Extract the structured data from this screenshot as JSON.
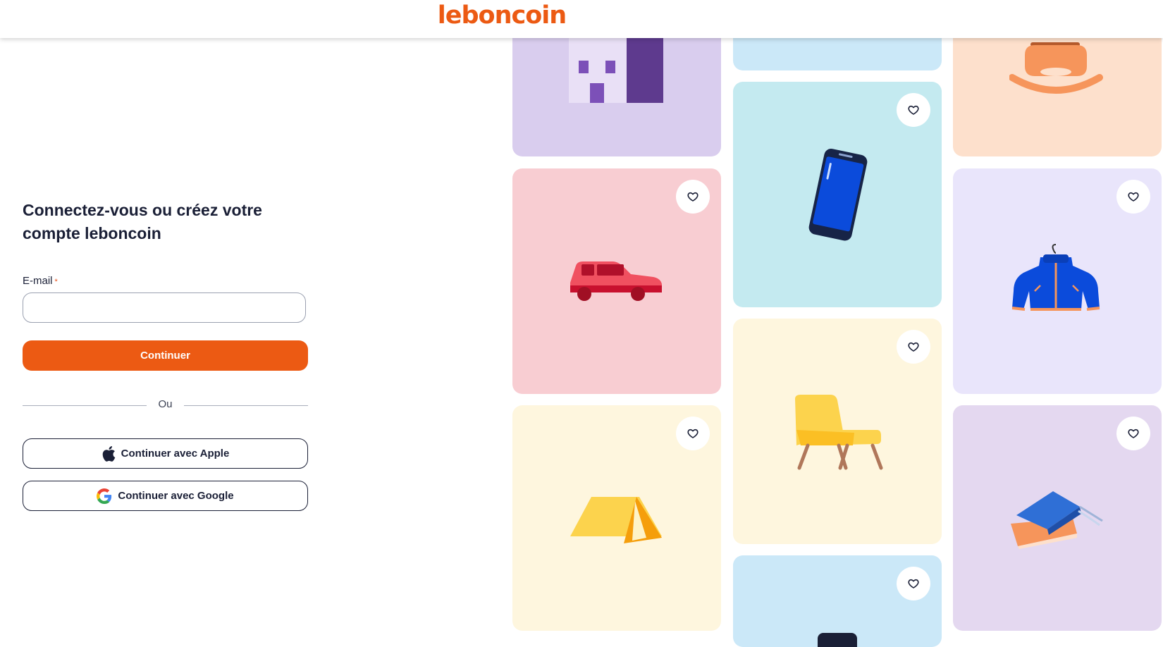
{
  "header": {
    "logo_text": "leboncoin",
    "logo_color": "#ec5a13"
  },
  "login": {
    "title": "Connectez-vous ou créez votre compte leboncoin",
    "email_label": "E-mail",
    "required_mark": "*",
    "email_value": "",
    "continue_label": "Continuer",
    "divider_text": "Ou",
    "apple_label": "Continuer avec Apple",
    "google_label": "Continuer avec Google"
  },
  "colors": {
    "primary": "#ec5a13",
    "lavender": "#d9cdee",
    "pink": "#f8cdd2",
    "light_yellow": "#fef6de",
    "light_blue": "#cbe8f8",
    "cyan": "#c4eaf0",
    "cream": "#fef6de",
    "peach": "#fde0cc",
    "light_purple": "#e9e5fb",
    "mauve": "#e4d8f0"
  },
  "cards": [
    {
      "illustration": "building-icon",
      "favorite": false
    },
    {
      "illustration": "car-icon",
      "favorite": true
    },
    {
      "illustration": "tent-icon",
      "favorite": true
    },
    {
      "illustration": "sky-card",
      "favorite": false
    },
    {
      "illustration": "smartphone-icon",
      "favorite": true
    },
    {
      "illustration": "armchair-icon",
      "favorite": true
    },
    {
      "illustration": "phone-partial-icon",
      "favorite": true
    },
    {
      "illustration": "rocking-horse-icon",
      "favorite": false
    },
    {
      "illustration": "jacket-icon",
      "favorite": true
    },
    {
      "illustration": "books-icon",
      "favorite": true
    }
  ]
}
